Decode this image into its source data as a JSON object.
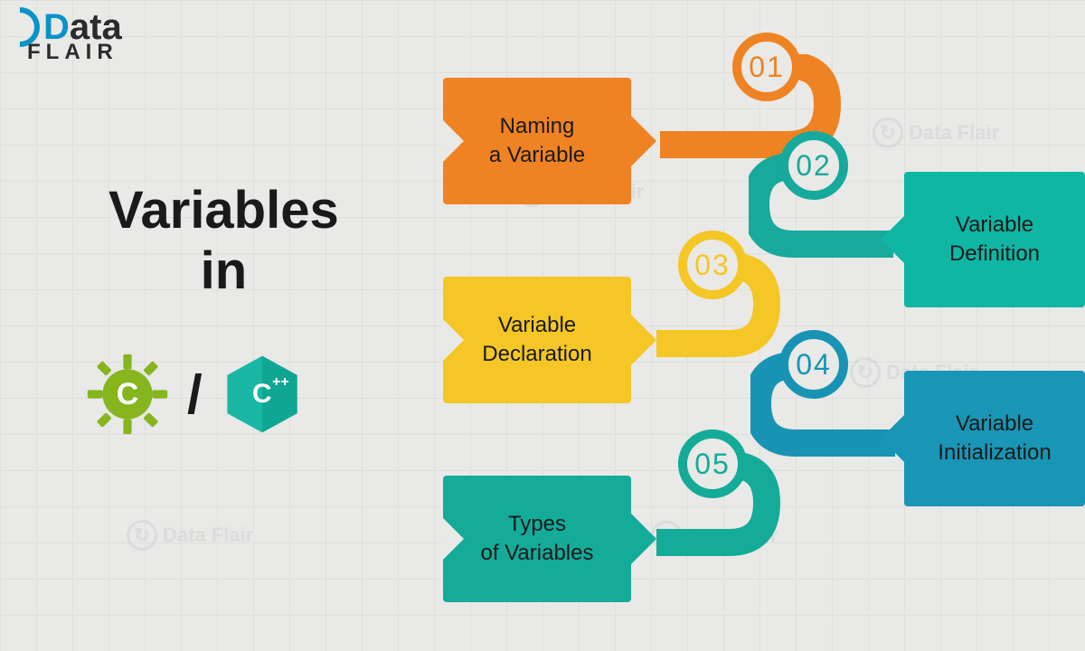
{
  "logo": {
    "part1": "D",
    "part2": "ata",
    "part3": "FLAIR"
  },
  "title_line1": "Variables",
  "title_line2": "in",
  "lang_c": "C",
  "lang_cpp_main": "C",
  "lang_cpp_sup": "++",
  "slash": "/",
  "steps": [
    {
      "num": "01",
      "label": "Naming\na Variable",
      "color": "#ef8222",
      "textColor": "#1a1a1a"
    },
    {
      "num": "02",
      "label": "Variable\nDefinition",
      "color": "#17a99b",
      "textColor": "#1a1a1a",
      "side": "right"
    },
    {
      "num": "03",
      "label": "Variable\nDeclaration",
      "color": "#f4c626",
      "textColor": "#1a1a1a"
    },
    {
      "num": "04",
      "label": "Variable\nInitialization",
      "color": "#1893b4",
      "textColor": "#1a1a1a",
      "side": "right"
    },
    {
      "num": "05",
      "label": "Types\nof Variables",
      "color": "#14ab99",
      "textColor": "#1a1a1a"
    }
  ],
  "watermark_text": "Data Flair"
}
